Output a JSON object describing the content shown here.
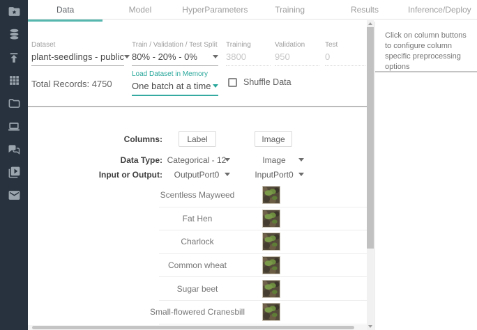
{
  "app": {
    "accent_color": "#4db6ac",
    "sidebar_color": "#28323e"
  },
  "sidebar": {
    "icons": [
      {
        "name": "projects-folder-star"
      },
      {
        "name": "datasets-database"
      },
      {
        "name": "upload"
      },
      {
        "name": "apps-grid"
      },
      {
        "name": "files-folder"
      },
      {
        "name": "devices-laptop"
      },
      {
        "name": "chat"
      },
      {
        "name": "media-library"
      },
      {
        "name": "mail"
      }
    ]
  },
  "tabs": [
    {
      "label": "Data",
      "active": true
    },
    {
      "label": "Model",
      "active": false
    },
    {
      "label": "HyperParameters",
      "active": false
    },
    {
      "label": "Training",
      "active": false
    },
    {
      "label": "Results",
      "active": false
    },
    {
      "label": "Inference/Deploy",
      "active": false
    }
  ],
  "dataset_panel": {
    "dataset": {
      "label": "Dataset",
      "value": "plant-seedlings - public"
    },
    "split": {
      "label": "Train / Validation / Test Split",
      "value": "80% - 20% - 0%"
    },
    "training": {
      "label": "Training",
      "value": "3800"
    },
    "validation": {
      "label": "Validation",
      "value": "950"
    },
    "test": {
      "label": "Test",
      "value": "0"
    },
    "total_records": "Total Records: 4750",
    "load_dataset": {
      "label": "Load Dataset in Memory",
      "value": "One batch at a time"
    },
    "shuffle_label": "Shuffle Data",
    "shuffle_checked": false
  },
  "columns_table": {
    "header_labels": {
      "columns": "Columns:",
      "data_type": "Data Type:",
      "input_or_output": "Input or Output:"
    },
    "columns": [
      {
        "name": "Label",
        "data_type": "Categorical - 12",
        "port": "OutputPort0"
      },
      {
        "name": "Image",
        "data_type": "Image",
        "port": "InputPort0"
      }
    ],
    "rows": [
      {
        "label": "Scentless Mayweed"
      },
      {
        "label": "Fat Hen"
      },
      {
        "label": "Charlock"
      },
      {
        "label": "Common wheat"
      },
      {
        "label": "Sugar beet"
      },
      {
        "label": "Small-flowered Cranesbill"
      }
    ]
  },
  "right_panel": {
    "hint": "Click on column buttons to configure column specific preprocessing options"
  }
}
